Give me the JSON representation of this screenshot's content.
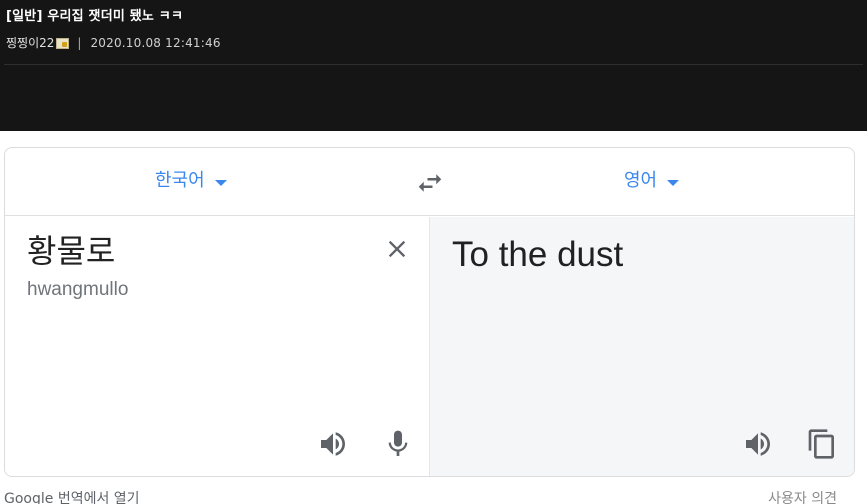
{
  "post": {
    "title": "[일반] 우리집 잿더미 됐노 ㅋㅋ",
    "author": "찡찡이22",
    "separator": "|",
    "datetime": "2020.10.08 12:41:46"
  },
  "translator": {
    "source_lang": "한국어",
    "target_lang": "영어",
    "source_text": "황물로",
    "romanization": "hwangmullo",
    "result_text": "To the dust",
    "footer_left": "Google 번역에서 열기",
    "footer_right": "사용자 의견",
    "icons": {
      "swap": "swap-arrows-icon",
      "clear": "close-icon",
      "source_speak": "speaker-icon",
      "mic": "microphone-icon",
      "target_speak": "speaker-icon",
      "copy": "copy-icon"
    },
    "colors": {
      "accent": "#1a73e8",
      "icon": "#5f6368"
    }
  }
}
